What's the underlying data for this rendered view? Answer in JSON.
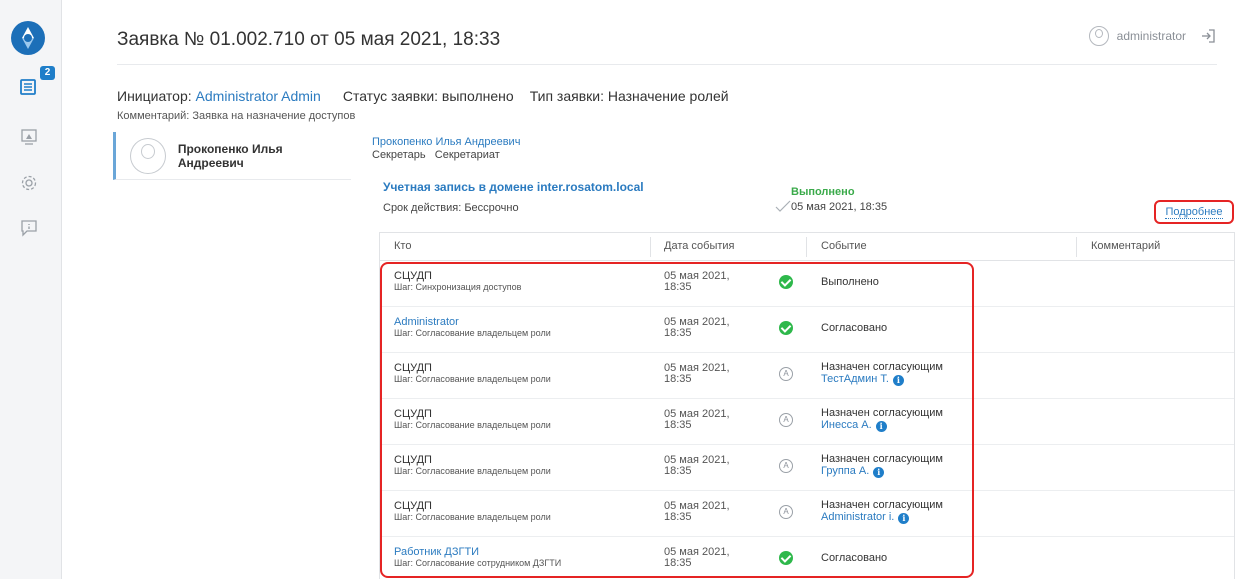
{
  "header": {
    "title": "Заявка № 01.002.710 от 05 мая 2021, 18:33",
    "user": "administrator"
  },
  "sidebar": {
    "badge_count": "2",
    "icons": [
      "requests-icon",
      "monitor-icon",
      "settings-icon",
      "feedback-icon"
    ]
  },
  "request": {
    "initiator_label": "Инициатор:",
    "initiator_name": "Administrator Admin",
    "status": "Статус заявки: выполнено",
    "type": "Тип заявки: Назначение ролей",
    "comment": "Комментарий: Заявка на назначение доступов"
  },
  "person": {
    "card_name": "Прокопенко Илья Андреевич",
    "full_name": "Прокопенко Илья Андреевич",
    "role": "Секретарь   Секретариат"
  },
  "account": {
    "title": "Учетная запись в домене inter.rosatom.local",
    "term": "Срок действия: Бессрочно",
    "status_label": "Выполнено",
    "status_date": "05 мая 2021, 18:35",
    "more_label": "Подробнее"
  },
  "table": {
    "columns": [
      "Кто",
      "Дата события",
      "Событие",
      "Комментарий"
    ],
    "rows": [
      {
        "who": "СЦУДП",
        "step": "Шаг: Синхронизация доступов",
        "date1": "05 мая 2021,",
        "date2": "18:35",
        "event": "Выполнено",
        "assignee": ""
      },
      {
        "who": "Administrator",
        "step": "Шаг: Согласование владельцем роли",
        "date1": "05 мая 2021,",
        "date2": "18:35",
        "event": "Согласовано",
        "assignee": ""
      },
      {
        "who": "СЦУДП",
        "step": "Шаг: Согласование владельцем роли",
        "date1": "05 мая 2021,",
        "date2": "18:35",
        "event": "Назначен согласующим",
        "assignee": "ТестАдмин Т."
      },
      {
        "who": "СЦУДП",
        "step": "Шаг: Согласование владельцем роли",
        "date1": "05 мая 2021,",
        "date2": "18:35",
        "event": "Назначен согласующим",
        "assignee": "Инесса А."
      },
      {
        "who": "СЦУДП",
        "step": "Шаг: Согласование владельцем роли",
        "date1": "05 мая 2021,",
        "date2": "18:35",
        "event": "Назначен согласующим",
        "assignee": "Группа А."
      },
      {
        "who": "СЦУДП",
        "step": "Шаг: Согласование владельцем роли",
        "date1": "05 мая 2021,",
        "date2": "18:35",
        "event": "Назначен согласующим",
        "assignee": "Administrator i."
      },
      {
        "who": "Работник ДЗГТИ",
        "step": "Шаг: Согласование сотрудником ДЗГТИ",
        "date1": "05 мая 2021,",
        "date2": "18:35",
        "event": "Согласовано",
        "assignee": ""
      }
    ],
    "info_glyph": "i",
    "assign_glyph": "A"
  }
}
